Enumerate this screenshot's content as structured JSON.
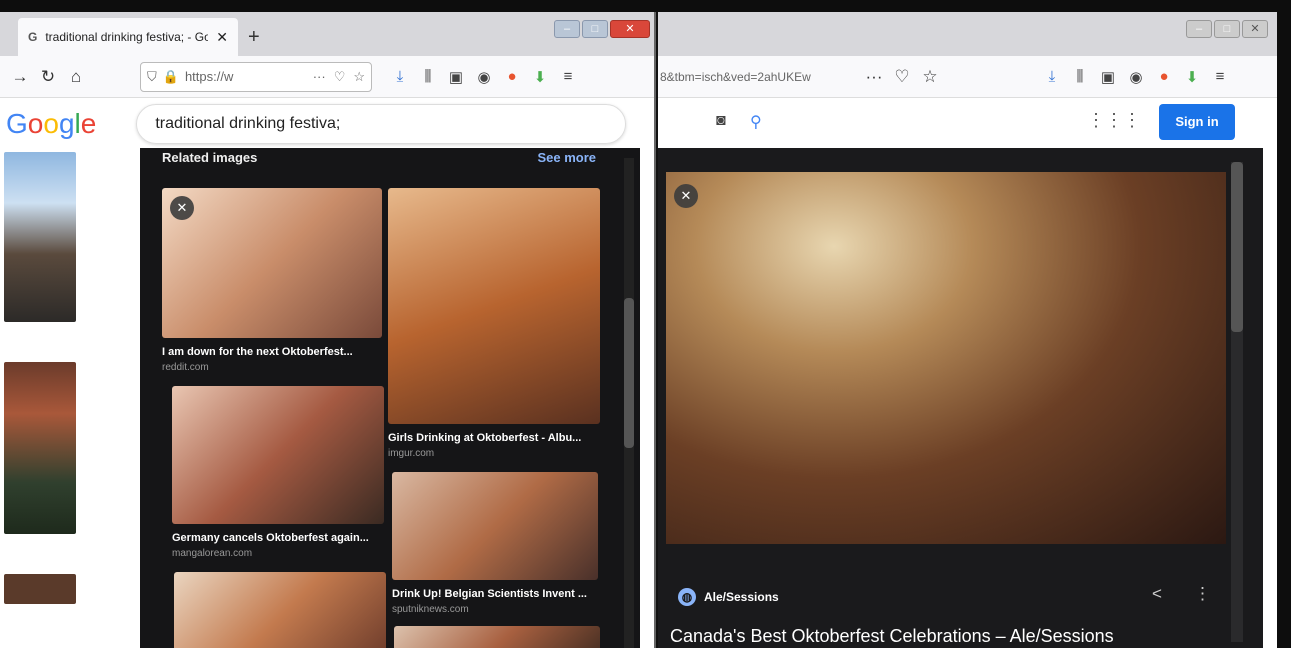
{
  "left_window": {
    "tab_title": "traditional drinking festiva; - Go",
    "tab_favicon": "G",
    "url": "https://w",
    "search": {
      "logo": "Google",
      "query": "traditional drinking festiva;"
    },
    "related": {
      "header": "Related images",
      "see_more": "See more",
      "items": [
        {
          "caption": "I am down for the next Oktoberfest...",
          "source": "reddit.com",
          "colors": [
            "#f3d9c4",
            "#c98d6a",
            "#7a4a3a"
          ]
        },
        {
          "caption": "Girls Drinking at Oktoberfest - Albu...",
          "source": "imgur.com",
          "colors": [
            "#e7b98c",
            "#b8642f",
            "#5a3120"
          ]
        },
        {
          "caption": "Germany cancels Oktoberfest again...",
          "source": "mangalorean.com",
          "colors": [
            "#e9c6b2",
            "#a55a42",
            "#3a2a22"
          ]
        },
        {
          "caption": "Drink Up! Belgian Scientists Invent ...",
          "source": "sputniknews.com",
          "colors": [
            "#d9b8a2",
            "#b06b46",
            "#49302a"
          ]
        },
        {
          "caption": "",
          "source": "",
          "colors": [
            "#ead5c0",
            "#c37a4e",
            "#6b3a2a"
          ]
        },
        {
          "caption": "",
          "source": "",
          "colors": [
            "#dcc2ad",
            "#a86040",
            "#3e2a20"
          ]
        }
      ]
    }
  },
  "right_window": {
    "url": "8&tbm=isch&ved=2ahUKEw",
    "sign_in": "Sign in",
    "preview": {
      "source": "Ale/Sessions",
      "title": "Canada's Best Oktoberfest Celebrations – Ale/Sessions"
    }
  }
}
